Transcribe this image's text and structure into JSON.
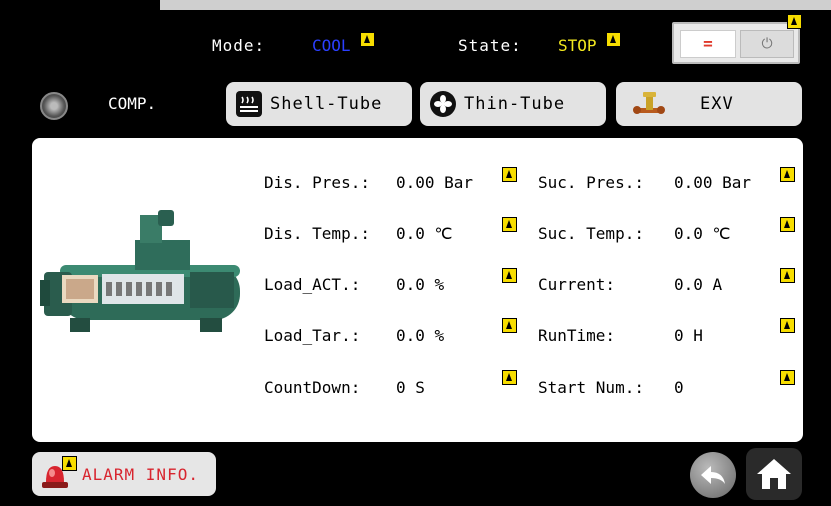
{
  "header": {
    "mode_label": "Mode:",
    "mode_value": "COOL",
    "state_label": "State:",
    "state_value": "STOP",
    "power_on_symbol": "=",
    "power_off_symbol": "⏻"
  },
  "nav": {
    "comp_label": "COMP.",
    "tabs": [
      {
        "label": "Shell-Tube",
        "icon": "heater-icon"
      },
      {
        "label": "Thin-Tube",
        "icon": "fan-icon"
      },
      {
        "label": "EXV",
        "icon": "valve-icon"
      }
    ]
  },
  "params": {
    "left": [
      {
        "label": "Dis. Pres.:",
        "value": "0.00 Bar"
      },
      {
        "label": "Dis. Temp.:",
        "value": "0.0 ℃"
      },
      {
        "label": "Load_ACT.:",
        "value": "0.0 %"
      },
      {
        "label": "Load_Tar.:",
        "value": "0.0 %"
      },
      {
        "label": "CountDown:",
        "value": "0 S"
      }
    ],
    "right": [
      {
        "label": "Suc. Pres.:",
        "value": "0.00 Bar"
      },
      {
        "label": "Suc. Temp.:",
        "value": "0.0 ℃"
      },
      {
        "label": "Current:",
        "value": "0.0 A"
      },
      {
        "label": "RunTime:",
        "value": "0 H"
      },
      {
        "label": "Start Num.:",
        "value": "0"
      }
    ]
  },
  "footer": {
    "alarm_label": "ALARM INFO."
  },
  "colors": {
    "mode": "#2b3fff",
    "state": "#f2e81f",
    "alarm": "#d8252f",
    "warning": "#f7dd00"
  }
}
